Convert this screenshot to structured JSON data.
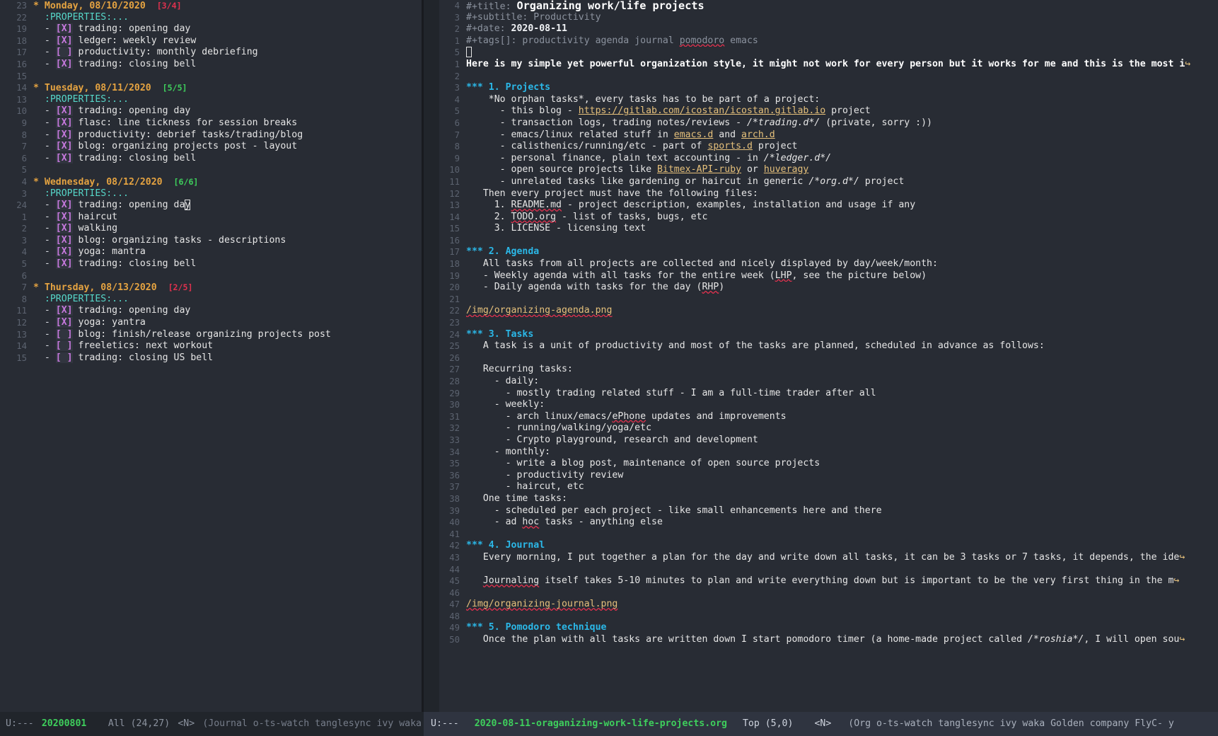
{
  "window": {
    "title": "Emacs — org journal and work/life projects"
  },
  "left_pane": {
    "name": "journal-buffer",
    "lines": [
      {
        "num": "23",
        "kind": "heading",
        "text": "* Monday, 08/10/2020",
        "cookie": "[3/4]",
        "cookie_state": "todo"
      },
      {
        "num": "22",
        "kind": "drawer",
        "text": ":PROPERTIES:..."
      },
      {
        "num": "19",
        "kind": "task",
        "box": "[X]",
        "text": "trading: opening day"
      },
      {
        "num": "18",
        "kind": "task",
        "box": "[X]",
        "text": "ledger: weekly review"
      },
      {
        "num": "17",
        "kind": "task",
        "box": "[ ]",
        "text": "productivity: monthly debriefing"
      },
      {
        "num": "16",
        "kind": "task",
        "box": "[X]",
        "text": "trading: closing bell"
      },
      {
        "num": "15",
        "kind": "blank",
        "text": ""
      },
      {
        "num": "14",
        "kind": "heading",
        "text": "* Tuesday, 08/11/2020",
        "cookie": "[5/5]",
        "cookie_state": "done"
      },
      {
        "num": "13",
        "kind": "drawer",
        "text": ":PROPERTIES:..."
      },
      {
        "num": "10",
        "kind": "task",
        "box": "[X]",
        "text": "trading: opening day"
      },
      {
        "num": "9",
        "kind": "task",
        "box": "[X]",
        "text": "flasc: line tickness for session breaks"
      },
      {
        "num": "8",
        "kind": "task",
        "box": "[X]",
        "text": "productivity: debrief tasks/trading/blog"
      },
      {
        "num": "7",
        "kind": "task",
        "box": "[X]",
        "text": "blog: organizing projects post - layout"
      },
      {
        "num": "6",
        "kind": "task",
        "box": "[X]",
        "text": "trading: closing bell"
      },
      {
        "num": "5",
        "kind": "blank",
        "text": ""
      },
      {
        "num": "4",
        "kind": "heading",
        "text": "* Wednesday, 08/12/2020",
        "cookie": "[6/6]",
        "cookie_state": "done"
      },
      {
        "num": "3",
        "kind": "drawer",
        "text": ":PROPERTIES:..."
      },
      {
        "num": "24",
        "kind": "task",
        "box": "[X]",
        "text": "trading: opening day",
        "cursor_at_end": true
      },
      {
        "num": "1",
        "kind": "task",
        "box": "[X]",
        "text": "haircut"
      },
      {
        "num": "2",
        "kind": "task",
        "box": "[X]",
        "text": "walking"
      },
      {
        "num": "3",
        "kind": "task",
        "box": "[X]",
        "text": "blog: organizing tasks - descriptions"
      },
      {
        "num": "4",
        "kind": "task",
        "box": "[X]",
        "text": "yoga: mantra"
      },
      {
        "num": "5",
        "kind": "task",
        "box": "[X]",
        "text": "trading: closing bell"
      },
      {
        "num": "6",
        "kind": "blank",
        "text": ""
      },
      {
        "num": "7",
        "kind": "heading",
        "text": "* Thursday, 08/13/2020",
        "cookie": "[2/5]",
        "cookie_state": "todo"
      },
      {
        "num": "8",
        "kind": "drawer",
        "text": ":PROPERTIES:..."
      },
      {
        "num": "11",
        "kind": "task",
        "box": "[X]",
        "text": "trading: opening day"
      },
      {
        "num": "12",
        "kind": "task",
        "box": "[X]",
        "text": "yoga: yantra"
      },
      {
        "num": "13",
        "kind": "task",
        "box": "[ ]",
        "text": "blog: finish/release organizing projects post"
      },
      {
        "num": "14",
        "kind": "task",
        "box": "[ ]",
        "text": "freeletics: next workout"
      },
      {
        "num": "15",
        "kind": "task",
        "box": "[ ]",
        "text": "trading: closing US bell"
      }
    ],
    "modeline": {
      "status": "U:---",
      "buffer": "20200801",
      "position": "All (24,27)",
      "state": "<N>",
      "minor_modes": "(Journal o-ts-watch tanglesync ivy waka"
    }
  },
  "right_pane": {
    "name": "org-document-buffer",
    "lines": [
      {
        "num": "4",
        "segs": [
          {
            "t": "#+title: ",
            "c": "keyword"
          },
          {
            "t": "Organizing work/life projects",
            "c": "title-val"
          }
        ]
      },
      {
        "num": "3",
        "segs": [
          {
            "t": "#+subtitle: ",
            "c": "keyword"
          },
          {
            "t": "Productivity",
            "c": "keyword"
          }
        ]
      },
      {
        "num": "2",
        "segs": [
          {
            "t": "#+date: ",
            "c": "keyword"
          },
          {
            "t": "2020-08-11",
            "c": "meta-val"
          }
        ]
      },
      {
        "num": "1",
        "segs": [
          {
            "t": "#+tags[]: productivity agenda journal ",
            "c": "keyword"
          },
          {
            "t": "pomodoro",
            "c": "keyword spell"
          },
          {
            "t": " emacs",
            "c": "keyword"
          }
        ]
      },
      {
        "num": "5",
        "segs": [
          {
            "t": "",
            "c": "body"
          }
        ],
        "cursor_box": true
      },
      {
        "num": "1",
        "segs": [
          {
            "t": "Here is my simple yet powerful organization style, it might not work for every person but it works for me and this is the most i",
            "c": "bold"
          }
        ],
        "cont": true
      },
      {
        "num": "2",
        "segs": []
      },
      {
        "num": "3",
        "segs": [
          {
            "t": "*** ",
            "c": "stars"
          },
          {
            "t": "1. Projects",
            "c": "h3"
          }
        ]
      },
      {
        "num": "4",
        "segs": [
          {
            "t": "    ",
            "c": "body"
          },
          {
            "t": "*No orphan tasks*",
            "c": "body"
          },
          {
            "t": ", every tasks has to be part of a project:",
            "c": "body"
          }
        ]
      },
      {
        "num": "5",
        "segs": [
          {
            "t": "      - this blog - ",
            "c": "body"
          },
          {
            "t": "https://gitlab.com/icostan/icostan.gitlab.io",
            "c": "link"
          },
          {
            "t": " project",
            "c": "body"
          }
        ]
      },
      {
        "num": "6",
        "segs": [
          {
            "t": "      - transaction logs, trading notes/reviews - ",
            "c": "body"
          },
          {
            "t": "/*trading.d*/",
            "c": "italic"
          },
          {
            "t": " (private, sorry :))",
            "c": "body"
          }
        ]
      },
      {
        "num": "7",
        "segs": [
          {
            "t": "      - emacs/linux related stuff in ",
            "c": "body"
          },
          {
            "t": "emacs.d",
            "c": "link"
          },
          {
            "t": " and ",
            "c": "body"
          },
          {
            "t": "arch.d",
            "c": "link"
          }
        ]
      },
      {
        "num": "8",
        "segs": [
          {
            "t": "      - calisthenics/running/etc - part of ",
            "c": "body"
          },
          {
            "t": "sports.d",
            "c": "link"
          },
          {
            "t": " project",
            "c": "body"
          }
        ]
      },
      {
        "num": "9",
        "segs": [
          {
            "t": "      - personal finance, plain text accounting - in ",
            "c": "body"
          },
          {
            "t": "/*ledger.d*/",
            "c": "italic"
          }
        ]
      },
      {
        "num": "10",
        "segs": [
          {
            "t": "      - open source projects like ",
            "c": "body"
          },
          {
            "t": "Bitmex-API-ruby",
            "c": "link"
          },
          {
            "t": " or ",
            "c": "body"
          },
          {
            "t": "huveragy",
            "c": "link"
          }
        ]
      },
      {
        "num": "11",
        "segs": [
          {
            "t": "      - unrelated tasks like gardening or haircut in generic ",
            "c": "body"
          },
          {
            "t": "/*org.d*/",
            "c": "italic"
          },
          {
            "t": " project",
            "c": "body"
          }
        ]
      },
      {
        "num": "12",
        "segs": [
          {
            "t": "   Then every project must have the following files:",
            "c": "body"
          }
        ]
      },
      {
        "num": "13",
        "segs": [
          {
            "t": "     1. ",
            "c": "body"
          },
          {
            "t": "README.md",
            "c": "body spell"
          },
          {
            "t": " - project description, examples, installation and usage if any",
            "c": "body"
          }
        ]
      },
      {
        "num": "14",
        "segs": [
          {
            "t": "     2. ",
            "c": "body"
          },
          {
            "t": "TODO.org",
            "c": "body spell"
          },
          {
            "t": " - list of tasks, bugs, etc",
            "c": "body"
          }
        ]
      },
      {
        "num": "15",
        "segs": [
          {
            "t": "     3. LICENSE - licensing text",
            "c": "body"
          }
        ]
      },
      {
        "num": "16",
        "segs": []
      },
      {
        "num": "17",
        "segs": [
          {
            "t": "*** ",
            "c": "stars"
          },
          {
            "t": "2. Agenda",
            "c": "h3"
          }
        ]
      },
      {
        "num": "18",
        "segs": [
          {
            "t": "   All tasks from all projects are collected and nicely displayed by day/week/month:",
            "c": "body"
          }
        ]
      },
      {
        "num": "19",
        "segs": [
          {
            "t": "   - Weekly agenda with all tasks for the entire week (",
            "c": "body"
          },
          {
            "t": "LHP",
            "c": "body spell"
          },
          {
            "t": ", see the picture below)",
            "c": "body"
          }
        ]
      },
      {
        "num": "20",
        "segs": [
          {
            "t": "   - Daily agenda with tasks for the day (",
            "c": "body"
          },
          {
            "t": "RHP",
            "c": "body spell"
          },
          {
            "t": ")",
            "c": "body"
          }
        ]
      },
      {
        "num": "21",
        "segs": []
      },
      {
        "num": "22",
        "segs": [
          {
            "t": "/img/organizing-agenda.png",
            "c": "link spell"
          }
        ]
      },
      {
        "num": "23",
        "segs": []
      },
      {
        "num": "24",
        "segs": [
          {
            "t": "*** ",
            "c": "stars"
          },
          {
            "t": "3. Tasks",
            "c": "h3"
          }
        ]
      },
      {
        "num": "25",
        "segs": [
          {
            "t": "   A task is a unit of productivity and most of the tasks are planned, scheduled in advance as follows:",
            "c": "body"
          }
        ]
      },
      {
        "num": "26",
        "segs": []
      },
      {
        "num": "27",
        "segs": [
          {
            "t": "   Recurring tasks:",
            "c": "body"
          }
        ]
      },
      {
        "num": "28",
        "segs": [
          {
            "t": "     - daily:",
            "c": "body"
          }
        ]
      },
      {
        "num": "29",
        "segs": [
          {
            "t": "       - mostly trading related stuff - I am a full-time trader after all",
            "c": "body"
          }
        ]
      },
      {
        "num": "30",
        "segs": [
          {
            "t": "     - weekly:",
            "c": "body"
          }
        ]
      },
      {
        "num": "31",
        "segs": [
          {
            "t": "       - arch linux/emacs/",
            "c": "body"
          },
          {
            "t": "ePhone",
            "c": "body spell"
          },
          {
            "t": " updates and improvements",
            "c": "body"
          }
        ]
      },
      {
        "num": "32",
        "segs": [
          {
            "t": "       - running/walking/yoga/etc",
            "c": "body"
          }
        ]
      },
      {
        "num": "33",
        "segs": [
          {
            "t": "       - Crypto playground, research and development",
            "c": "body"
          }
        ]
      },
      {
        "num": "34",
        "segs": [
          {
            "t": "     - monthly:",
            "c": "body"
          }
        ]
      },
      {
        "num": "35",
        "segs": [
          {
            "t": "       - write a blog post, maintenance of open source projects",
            "c": "body"
          }
        ]
      },
      {
        "num": "36",
        "segs": [
          {
            "t": "       - productivity review",
            "c": "body"
          }
        ]
      },
      {
        "num": "37",
        "segs": [
          {
            "t": "       - haircut, etc",
            "c": "body"
          }
        ]
      },
      {
        "num": "38",
        "segs": [
          {
            "t": "   One time tasks:",
            "c": "body"
          }
        ]
      },
      {
        "num": "39",
        "segs": [
          {
            "t": "     - scheduled per each project - like small enhancements here and there",
            "c": "body"
          }
        ]
      },
      {
        "num": "40",
        "segs": [
          {
            "t": "     - ad ",
            "c": "body"
          },
          {
            "t": "hoc",
            "c": "body spell"
          },
          {
            "t": " tasks - anything else",
            "c": "body"
          }
        ]
      },
      {
        "num": "41",
        "segs": []
      },
      {
        "num": "42",
        "segs": [
          {
            "t": "*** ",
            "c": "stars"
          },
          {
            "t": "4. Journal",
            "c": "h3"
          }
        ]
      },
      {
        "num": "43",
        "segs": [
          {
            "t": "   Every morning, I put together a plan for the day and write down all tasks, it can be 3 tasks or 7 tasks, it depends, the ide",
            "c": "body"
          }
        ],
        "cont": true
      },
      {
        "num": "44",
        "segs": []
      },
      {
        "num": "45",
        "segs": [
          {
            "t": "   ",
            "c": "body"
          },
          {
            "t": "Journaling",
            "c": "body spell"
          },
          {
            "t": " itself takes 5-10 minutes to plan and write everything down but is important to be the very first thing in the m",
            "c": "body"
          }
        ],
        "cont": true
      },
      {
        "num": "46",
        "segs": []
      },
      {
        "num": "47",
        "segs": [
          {
            "t": "/img/organizing-journal.png",
            "c": "link spell"
          }
        ]
      },
      {
        "num": "48",
        "segs": []
      },
      {
        "num": "49",
        "segs": [
          {
            "t": "*** ",
            "c": "stars"
          },
          {
            "t": "5. Pomodoro technique",
            "c": "h3"
          }
        ]
      },
      {
        "num": "50",
        "segs": [
          {
            "t": "   Once the plan with all tasks are written down I start pomodoro timer (a home-made project called ",
            "c": "body"
          },
          {
            "t": "/*roshia*/",
            "c": "italic"
          },
          {
            "t": ", I will open sou",
            "c": "body"
          }
        ],
        "cont": true
      }
    ],
    "modeline": {
      "status": "U:---",
      "buffer": "2020-08-11-oraganizing-work-life-projects.org",
      "position": "Top (5,0)",
      "state": "<N>",
      "minor_modes": "(Org o-ts-watch tanglesync ivy waka Golden company FlyC- y"
    }
  }
}
